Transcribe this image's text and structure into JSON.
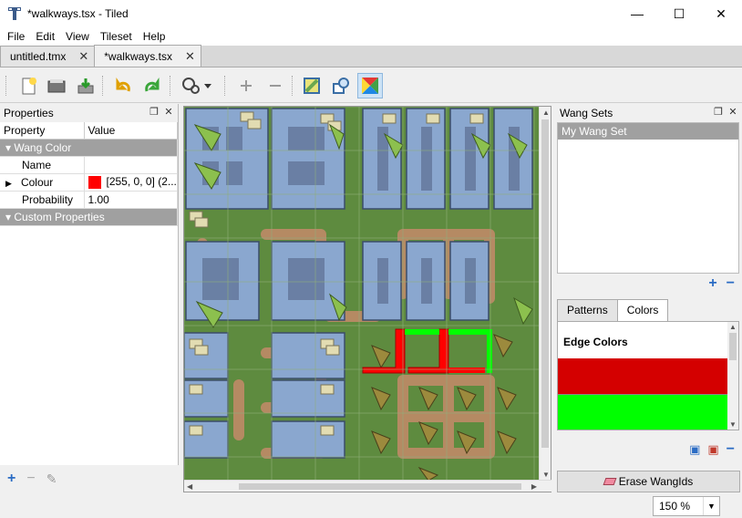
{
  "window": {
    "title": "*walkways.tsx - Tiled",
    "minimize": "—",
    "maximize": "☐",
    "close": "✕"
  },
  "menu": [
    "File",
    "Edit",
    "View",
    "Tileset",
    "Help"
  ],
  "tabs": [
    {
      "label": "untitled.tmx",
      "close": "✕"
    },
    {
      "label": "*walkways.tsx",
      "close": "✕"
    }
  ],
  "properties": {
    "title": "Properties",
    "col_property": "Property",
    "col_value": "Value",
    "group1": "Wang Color",
    "rows": [
      {
        "name": "Name",
        "value": ""
      },
      {
        "name": "Colour",
        "value": "[255, 0, 0] (2..."
      },
      {
        "name": "Probability",
        "value": "1.00"
      }
    ],
    "group2": "Custom Properties"
  },
  "wang_sets": {
    "title": "Wang Sets",
    "items": [
      "My Wang Set"
    ],
    "tabs": [
      "Patterns",
      "Colors"
    ],
    "edge_colors_label": "Edge Colors",
    "edge_colors": [
      "#d40000",
      "#00ff00"
    ],
    "erase_label": "Erase WangIds"
  },
  "zoom": "150 %",
  "colors": {
    "grass": "#5e8b3f",
    "path": "#b58a63",
    "wall": "#8aa7cf",
    "highlight_red": "#ff0000",
    "highlight_green": "#00ff00"
  }
}
